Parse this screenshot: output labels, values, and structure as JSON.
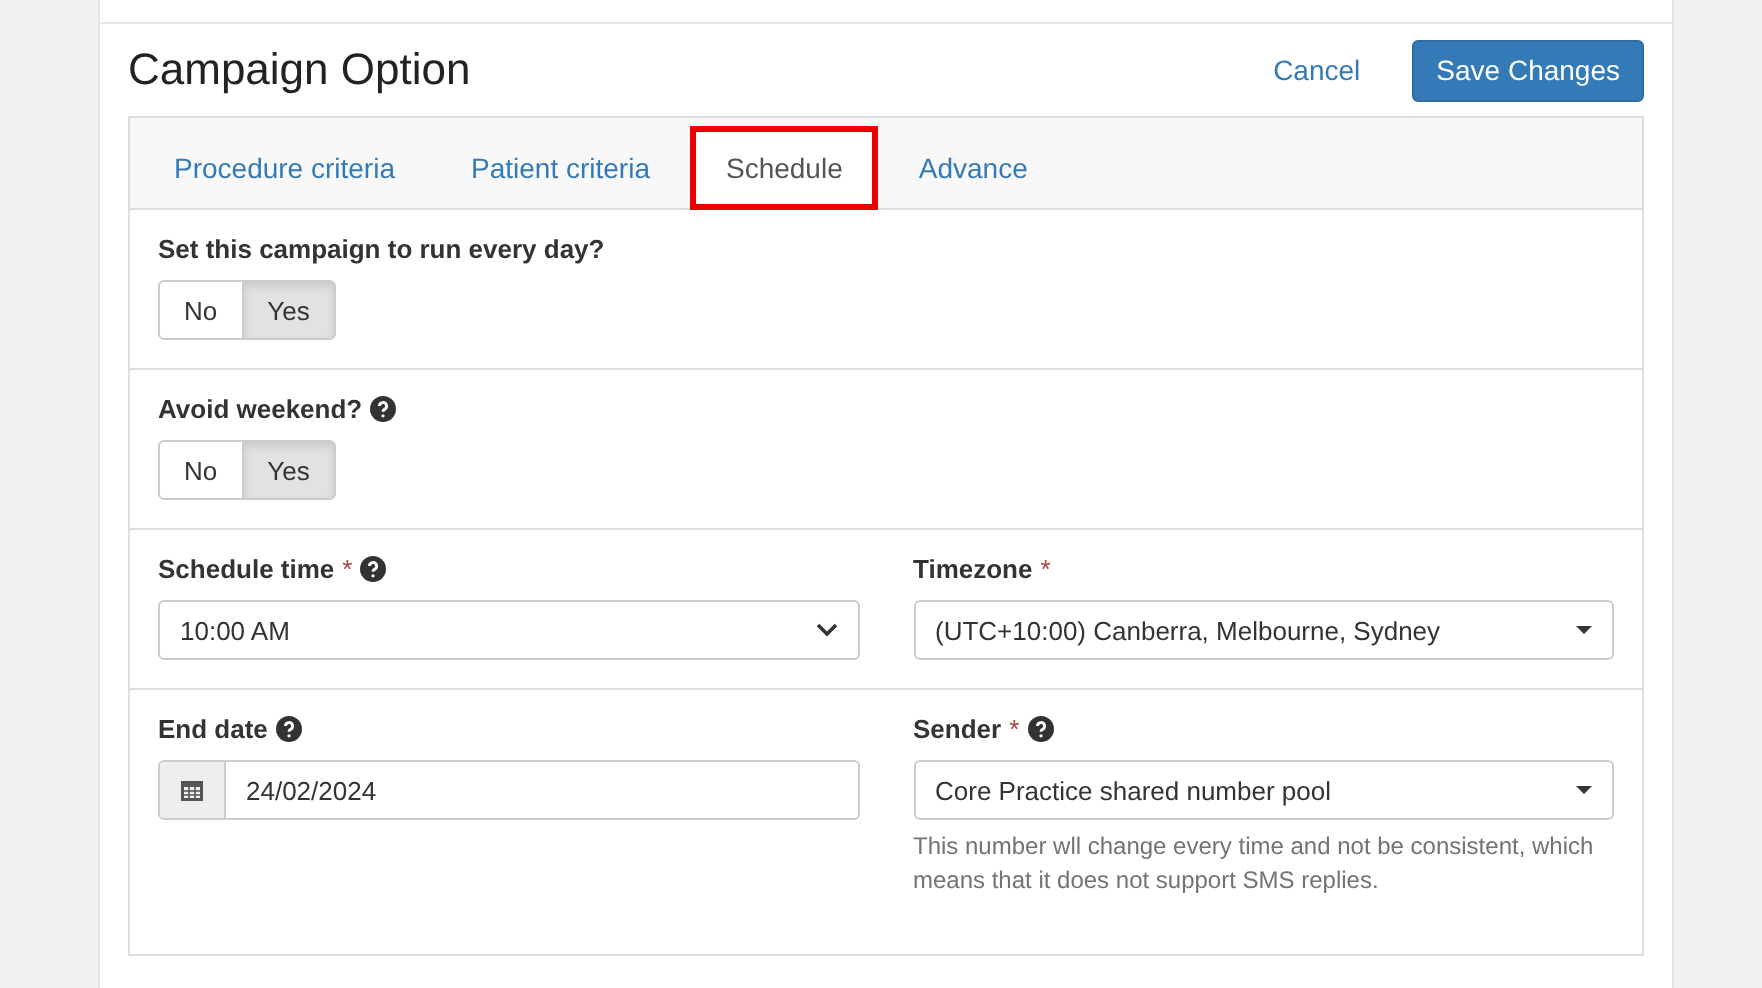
{
  "title": "Campaign Option",
  "actions": {
    "cancel": "Cancel",
    "save": "Save Changes"
  },
  "tabs": [
    {
      "label": "Procedure criteria",
      "selected": false
    },
    {
      "label": "Patient criteria",
      "selected": false
    },
    {
      "label": "Schedule",
      "selected": true
    },
    {
      "label": "Advance",
      "selected": false
    }
  ],
  "sections": [
    {
      "kind": "toggle",
      "label": "Set this campaign to run every day?",
      "help": false,
      "options": [
        {
          "label": "No",
          "selected": false
        },
        {
          "label": "Yes",
          "selected": true
        }
      ]
    },
    {
      "kind": "toggle",
      "label": "Avoid weekend?",
      "help": true,
      "options": [
        {
          "label": "No",
          "selected": false
        },
        {
          "label": "Yes",
          "selected": true
        }
      ]
    },
    {
      "kind": "pair",
      "fields": [
        {
          "kind": "native-select",
          "label": "Schedule time",
          "required_mark": "*",
          "help": true,
          "value": "10:00 AM"
        },
        {
          "kind": "dropdown",
          "label": "Timezone",
          "required_mark": "*",
          "help": false,
          "value": "(UTC+10:00) Canberra, Melbourne, Sydney"
        }
      ]
    },
    {
      "kind": "pair",
      "fields": [
        {
          "kind": "date",
          "label": "End date",
          "help": true,
          "value": "24/02/2024"
        },
        {
          "kind": "dropdown",
          "label": "Sender",
          "required_mark": "*",
          "help": true,
          "value": "Core Practice shared number pool",
          "note": "This number wll change every time and not be consistent, which means that it does not support SMS replies."
        }
      ]
    }
  ]
}
